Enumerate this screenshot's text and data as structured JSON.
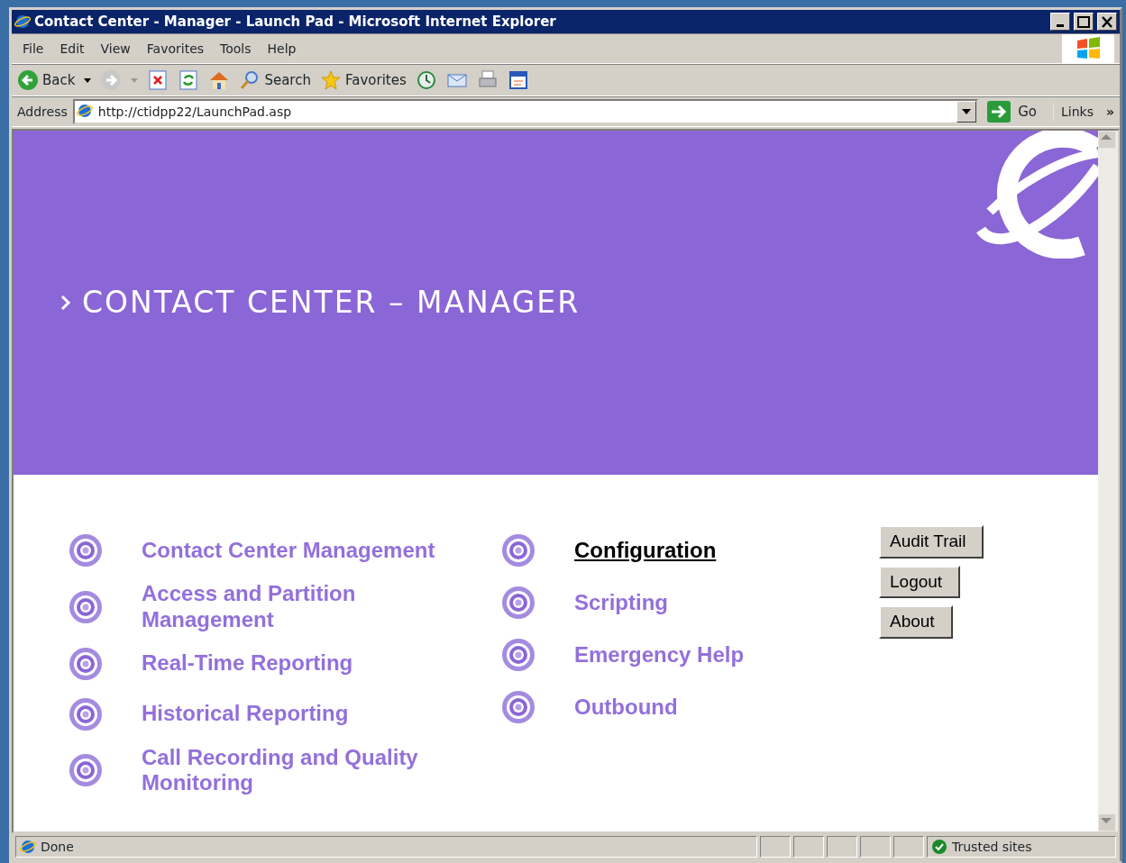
{
  "window": {
    "title": "Contact Center - Manager - Launch Pad - Microsoft Internet Explorer"
  },
  "menu": [
    "File",
    "Edit",
    "View",
    "Favorites",
    "Tools",
    "Help"
  ],
  "toolbar": [
    {
      "kind": "back",
      "label": "Back"
    },
    {
      "kind": "forward"
    },
    {
      "kind": "stop"
    },
    {
      "kind": "refresh"
    },
    {
      "kind": "home"
    },
    {
      "kind": "search",
      "label": "Search"
    },
    {
      "kind": "favorites",
      "label": "Favorites"
    },
    {
      "kind": "history"
    },
    {
      "kind": "mail"
    },
    {
      "kind": "print"
    },
    {
      "kind": "edit"
    }
  ],
  "address": {
    "label": "Address",
    "value": "http://ctidpp22/LaunchPad.asp",
    "go": "Go",
    "links": "Links",
    "more": "»"
  },
  "banner": {
    "title": "CONTACT CENTER – MANAGER"
  },
  "link_columns": [
    [
      {
        "label": "Contact Center Management",
        "highlighted": false
      },
      {
        "label": "Access and Partition Management",
        "highlighted": false
      },
      {
        "label": "Real-Time Reporting",
        "highlighted": false
      },
      {
        "label": "Historical Reporting",
        "highlighted": false
      },
      {
        "label": "Call Recording and Quality Monitoring",
        "highlighted": false
      }
    ],
    [
      {
        "label": "Configuration",
        "highlighted": true
      },
      {
        "label": "Scripting",
        "highlighted": false
      },
      {
        "label": "Emergency Help",
        "highlighted": false
      },
      {
        "label": "Outbound",
        "highlighted": false
      }
    ]
  ],
  "buttons": [
    "Audit Trail",
    "Logout",
    "About"
  ],
  "status_bar": {
    "text": "Done",
    "zone": "Trusted sites"
  }
}
